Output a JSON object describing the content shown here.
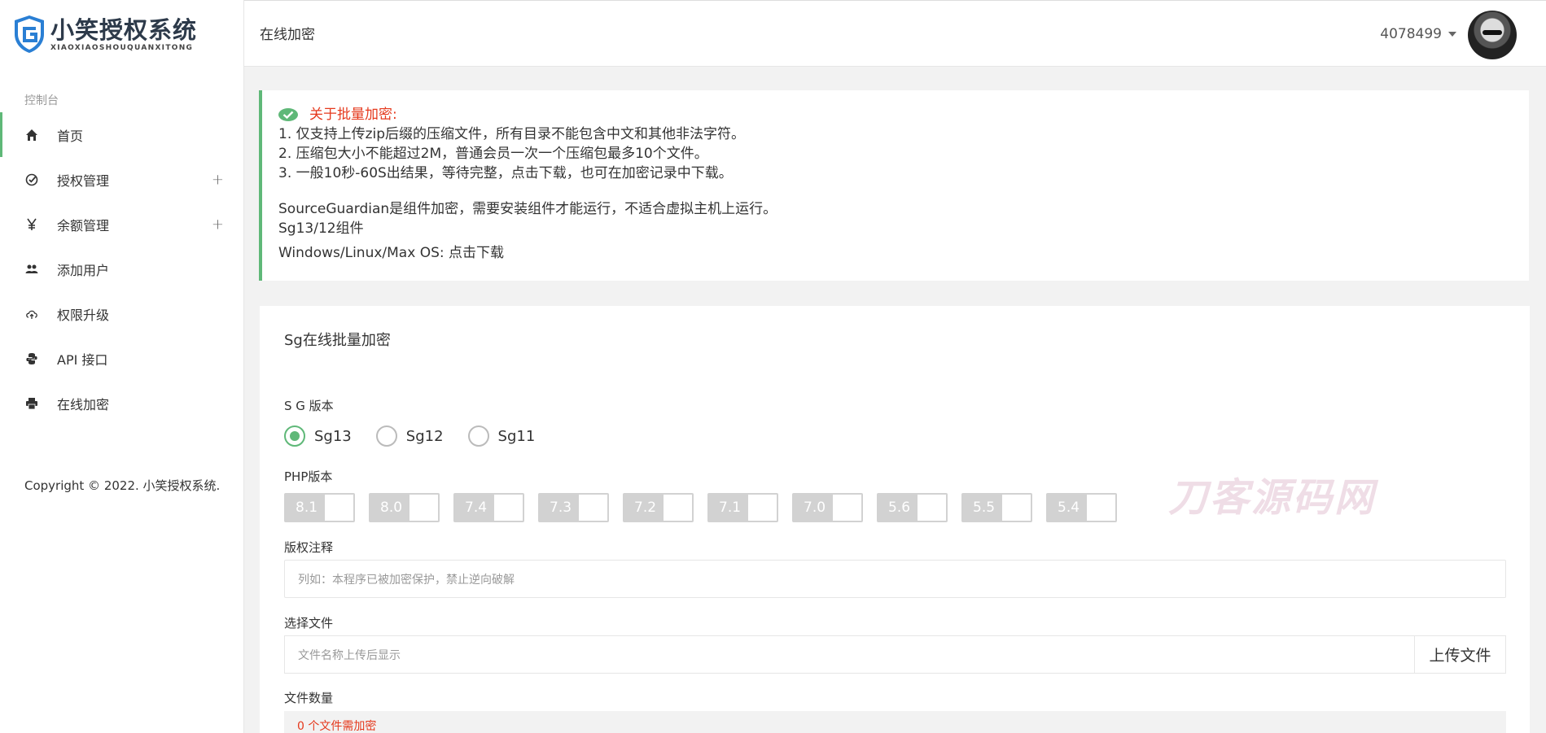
{
  "app": {
    "logo_title": "小笑授权系统",
    "logo_subtitle": "XIAOXIAOSHOUQUANXITONG"
  },
  "sidebar": {
    "group_label": "控制台",
    "items": [
      {
        "label": "首页",
        "icon": "home-icon",
        "active": true,
        "expandable": false
      },
      {
        "label": "授权管理",
        "icon": "check-circle-icon",
        "active": false,
        "expandable": true
      },
      {
        "label": "余额管理",
        "icon": "yen-icon",
        "active": false,
        "expandable": true
      },
      {
        "label": "添加用户",
        "icon": "users-icon",
        "active": false,
        "expandable": false
      },
      {
        "label": "权限升级",
        "icon": "cloud-upload-icon",
        "active": false,
        "expandable": false
      },
      {
        "label": "API 接口",
        "icon": "python-icon",
        "active": false,
        "expandable": false
      },
      {
        "label": "在线加密",
        "icon": "printer-icon",
        "active": false,
        "expandable": false
      }
    ],
    "copyright": "Copyright © 2022. 小笑授权系统."
  },
  "header": {
    "page_title": "在线加密",
    "username": "4078499"
  },
  "notice": {
    "title": "关于批量加密:",
    "lines": [
      "1. 仅支持上传zip后缀的压缩文件，所有目录不能包含中文和其他非法字符。",
      "2. 压缩包大小不能超过2M，普通会员一次一个压缩包最多10个文件。",
      "3. 一般10秒-60S出结果，等待完整，点击下载，也可在加密记录中下载。"
    ],
    "desc": "SourceGuardian是组件加密，需要安装组件才能运行，不适合虚拟主机上运行。",
    "component": "Sg13/12组件",
    "download_prefix": "Windows/Linux/Max OS: ",
    "download_link": "点击下载"
  },
  "form": {
    "card_title": "Sg在线批量加密",
    "sg_version_label": "S G 版本",
    "sg_versions": [
      {
        "label": "Sg13",
        "checked": true
      },
      {
        "label": "Sg12",
        "checked": false
      },
      {
        "label": "Sg11",
        "checked": false
      }
    ],
    "php_version_label": "PHP版本",
    "php_versions": [
      "8.1",
      "8.0",
      "7.4",
      "7.3",
      "7.2",
      "7.1",
      "7.0",
      "5.6",
      "5.5",
      "5.4"
    ],
    "copyright_label": "版权注释",
    "copyright_placeholder": "列如：本程序已被加密保护，禁止逆向破解",
    "file_label": "选择文件",
    "file_placeholder": "文件名称上传后显示",
    "upload_button": "上传文件",
    "count_label": "文件数量",
    "count_text": "0 个文件需加密"
  },
  "watermark": "刀客源码网",
  "colors": {
    "accent_green": "#5fb878",
    "notice_red": "#e5391d",
    "toggle_gray": "#d2d2d2"
  }
}
